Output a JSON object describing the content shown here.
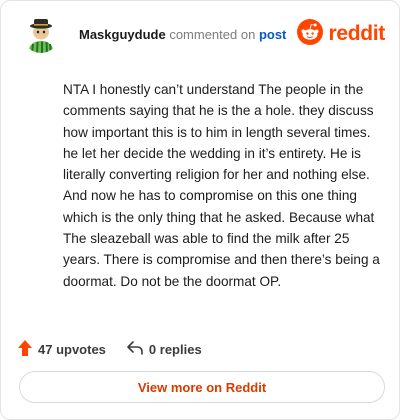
{
  "header": {
    "username": "Maskguydude",
    "action_text": "commented on",
    "link_text": "post",
    "logo_text": "reddit"
  },
  "comment": {
    "body": "NTA I honestly can’t understand The people in the comments saying that he is the a hole. they discuss how important this is to him in length several times. he let her decide the wedding in it’s entirety. He is literally converting religion for her and nothing else. And now he has to compromise on this one thing which is the only thing that he asked. Because what The sleazeball was able to find the milk after 25 years. There is compromise and then there’s being a doormat. Do not be the doormat OP."
  },
  "stats": {
    "upvotes_label": "47 upvotes",
    "replies_label": "0 replies"
  },
  "footer": {
    "view_more_label": "View more on Reddit"
  },
  "colors": {
    "accent": "#ff4500",
    "link": "#0a57c4",
    "button_text": "#d93a00"
  },
  "icons": [
    "avatar-image",
    "reddit-logo-icon",
    "upvote-arrow-icon",
    "reply-icon"
  ]
}
